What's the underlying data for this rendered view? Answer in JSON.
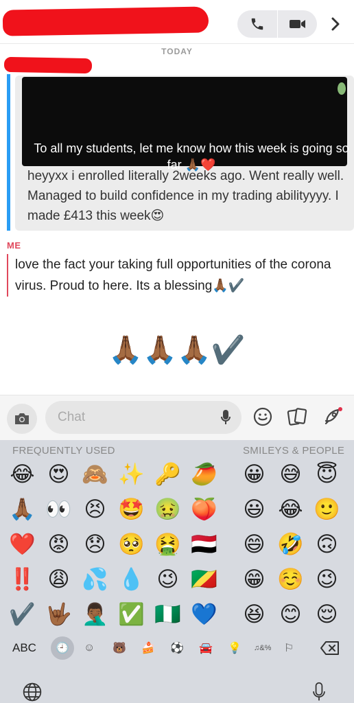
{
  "header": {
    "phone_icon": "phone-icon",
    "video_icon": "video-icon",
    "more_icon": "chevron-right-icon"
  },
  "today_label": "TODAY",
  "received": {
    "snap_caption": "To all my students, let me know how this week is going so far 🙏🏾❤️",
    "reply": "heyyxx i enrolled literally 2weeks ago. Went really well. Managed to build confidence in my trading abilityyyy. I made £413 this week😍"
  },
  "sent": {
    "sender_label": "ME",
    "text": "love the fact your taking full opportunities of the corona virus. Proud to here. Its a blessing🙏🏾✔️"
  },
  "big_emoji": "🙏🏾🙏🏾🙏🏾✔️",
  "chat_bar": {
    "placeholder": "Chat",
    "icons": [
      "camera-icon",
      "mic-icon",
      "smiley-icon",
      "cards-icon",
      "rocket-icon"
    ]
  },
  "keyboard": {
    "frequent_label": "FREQUENTLY USED",
    "smileys_label": "SMILEYS & PEOPLE",
    "frequent": [
      [
        "😂",
        "😍",
        "🙈",
        "✨",
        "🔑",
        "🥭"
      ],
      [
        "🙏🏾",
        "👀",
        "😣",
        "🤩",
        "🤢",
        "🍑"
      ],
      [
        "❤️",
        "😡",
        "😞",
        "🥺",
        "🤮",
        "🇾🇪"
      ],
      [
        "‼️",
        "😩",
        "💦",
        "💧",
        "😉",
        "🇨🇬"
      ],
      [
        "✔️",
        "🤟🏾",
        "🤦🏾‍♂️",
        "✅",
        "🇳🇬",
        "💙"
      ]
    ],
    "smileys": [
      [
        "😀",
        "😅",
        "😇"
      ],
      [
        "😃",
        "😂",
        "🙂"
      ],
      [
        "😄",
        "🤣",
        "🙃"
      ],
      [
        "😁",
        "☺️",
        "😉"
      ],
      [
        "😆",
        "😊",
        "😌"
      ]
    ],
    "abc_label": "ABC",
    "categories": [
      "🕘",
      "☺",
      "🐻",
      "🍰",
      "⚽",
      "🚘",
      "💡",
      "♫&%",
      "⚐"
    ],
    "delete_icon": "backspace-icon",
    "globe_icon": "globe-icon",
    "dictation_icon": "mic-icon"
  }
}
